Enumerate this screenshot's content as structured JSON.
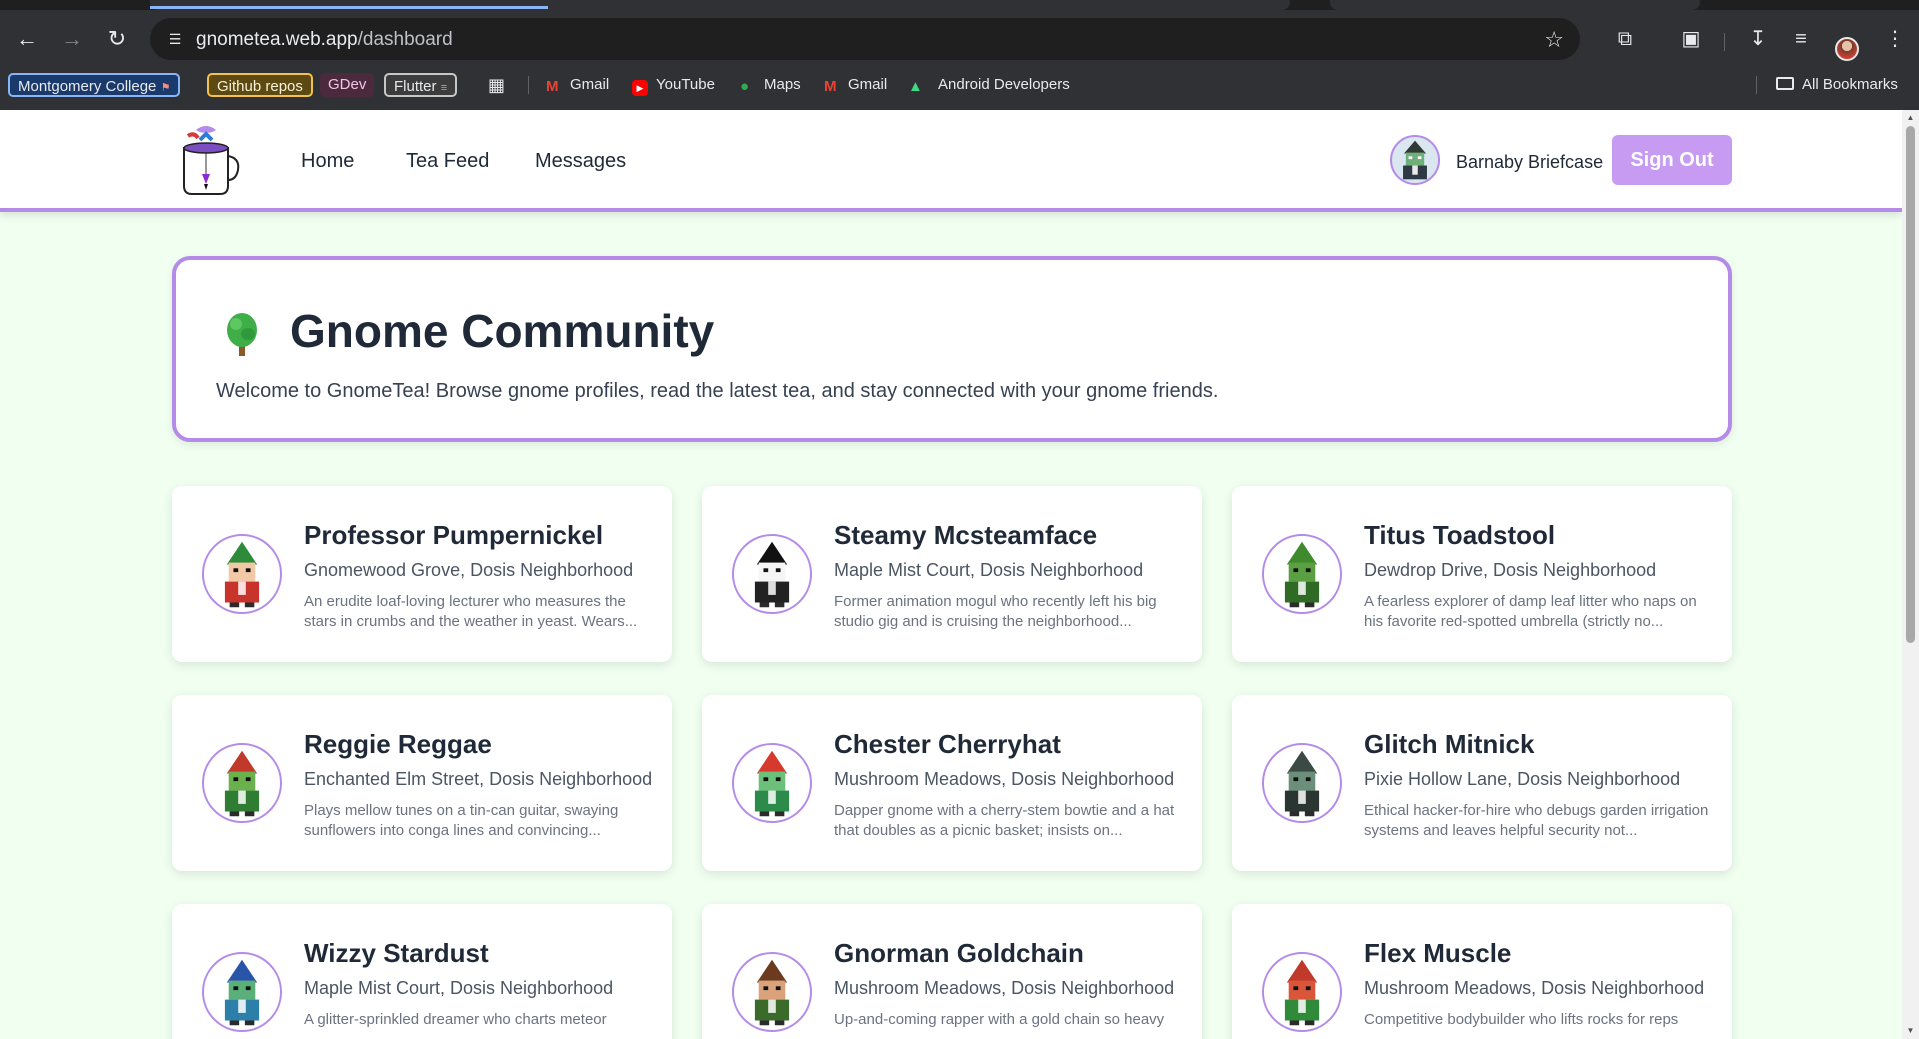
{
  "browser": {
    "url_host": "gnometea.web.app",
    "url_path": "/dashboard",
    "bookmarks": {
      "montgomery": "Montgomery College",
      "github": "Github repos",
      "gdev": "GDev",
      "flutter": "Flutter",
      "gmail1": "Gmail",
      "youtube": "YouTube",
      "maps": "Maps",
      "gmail2": "Gmail",
      "android": "Android Developers",
      "all": "All Bookmarks"
    }
  },
  "site": {
    "nav": {
      "home": "Home",
      "tea_feed": "Tea Feed",
      "messages": "Messages"
    },
    "user": {
      "name": "Barnaby Briefcase",
      "sign_out": "Sign Out"
    },
    "hero": {
      "title": "Gnome Community",
      "description": "Welcome to GnomeTea! Browse gnome profiles, read the latest tea, and stay connected with your gnome friends."
    },
    "gnomes": [
      {
        "name": "Professor Pumpernickel",
        "location": "Gnomewood Grove, Dosis Neighborhood",
        "bio": "An erudite loaf-loving lecturer who measures the stars in crumbs and the weather in yeast. Wears...",
        "hat": "#2e8b3a",
        "body": "#c8342b",
        "face": "#f2c9a6"
      },
      {
        "name": "Steamy Mcsteamface",
        "location": "Maple Mist Court, Dosis Neighborhood",
        "bio": "Former animation mogul who recently left his big studio gig and is cruising the neighborhood...",
        "hat": "#111111",
        "body": "#222222",
        "face": "#f5f5f5"
      },
      {
        "name": "Titus Toadstool",
        "location": "Dewdrop Drive, Dosis Neighborhood",
        "bio": "A fearless explorer of damp leaf litter who naps on his favorite red-spotted umbrella (strictly no...",
        "hat": "#3f8a2c",
        "body": "#2f6b25",
        "face": "#5aa043"
      },
      {
        "name": "Reggie Reggae",
        "location": "Enchanted Elm Street, Dosis Neighborhood",
        "bio": "Plays mellow tunes on a tin-can guitar, swaying sunflowers into conga lines and convincing...",
        "hat": "#c0392b",
        "body": "#2f7d32",
        "face": "#6ab04c"
      },
      {
        "name": "Chester Cherryhat",
        "location": "Mushroom Meadows, Dosis Neighborhood",
        "bio": "Dapper gnome with a cherry-stem bowtie and a hat that doubles as a picnic basket; insists on...",
        "hat": "#d63a2f",
        "body": "#2c8a4a",
        "face": "#6cc07a"
      },
      {
        "name": "Glitch Mitnick",
        "location": "Pixie Hollow Lane, Dosis Neighborhood",
        "bio": "Ethical hacker-for-hire who debugs garden irrigation systems and leaves helpful security not...",
        "hat": "#3b4a44",
        "body": "#2b3531",
        "face": "#6b8f7a"
      },
      {
        "name": "Wizzy Stardust",
        "location": "Maple Mist Court, Dosis Neighborhood",
        "bio": "A glitter-sprinkled dreamer who charts meteor",
        "hat": "#2855a8",
        "body": "#2c7fa8",
        "face": "#5bb07a"
      },
      {
        "name": "Gnorman Goldchain",
        "location": "Mushroom Meadows, Dosis Neighborhood",
        "bio": "Up-and-coming rapper with a gold chain so heavy",
        "hat": "#6b3a1f",
        "body": "#3a6b2a",
        "face": "#d9a27a"
      },
      {
        "name": "Flex Muscle",
        "location": "Mushroom Meadows, Dosis Neighborhood",
        "bio": "Competitive bodybuilder who lifts rocks for reps",
        "hat": "#c0392b",
        "body": "#2f8a3a",
        "face": "#d9563a"
      }
    ]
  },
  "colors": {
    "accent": "#b48be8",
    "page_bg": "#f0fff0",
    "sign_out_bg": "#c79bf2"
  }
}
